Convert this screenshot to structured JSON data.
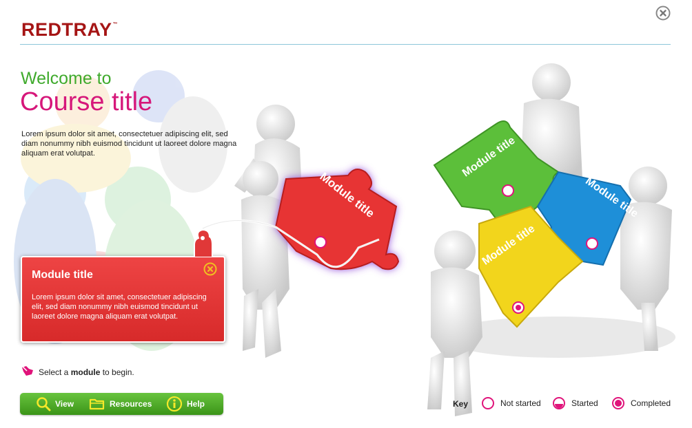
{
  "brand": {
    "name": "REDTRAY",
    "tm": "™"
  },
  "welcome": "Welcome to",
  "course_title": "Course title",
  "intro": "Lorem ipsum dolor sit amet, consectetuer adipiscing elit, sed diam nonummy nibh euismod tincidunt ut laoreet dolore magna aliquam erat volutpat.",
  "puzzle": {
    "red": "Module title",
    "green": "Module title",
    "blue": "Module title",
    "yellow": "Module title"
  },
  "module_card": {
    "title": "Module title",
    "body": "Lorem ipsum dolor sit amet, consectetuer adipiscing elit, sed diam nonummy nibh euismod tincidunt ut laoreet dolore magna aliquam erat volutpat."
  },
  "instruction": {
    "before": "Select a ",
    "bold": "module",
    "after": " to begin."
  },
  "toolbar": {
    "view": "View",
    "resources": "Resources",
    "help": "Help"
  },
  "key": {
    "label": "Key",
    "not_started": "Not started",
    "started": "Started",
    "completed": "Completed"
  },
  "colors": {
    "brand_red": "#a51515",
    "welcome_green": "#3faa2c",
    "title_pink": "#d6177a",
    "toolbar_green": "#4fae2a",
    "status_pink": "#e0137a"
  },
  "icons": [
    "close-icon",
    "search-icon",
    "folder-icon",
    "info-icon",
    "pointer-hand-icon",
    "status-not-started-icon",
    "status-started-icon",
    "status-completed-icon"
  ]
}
